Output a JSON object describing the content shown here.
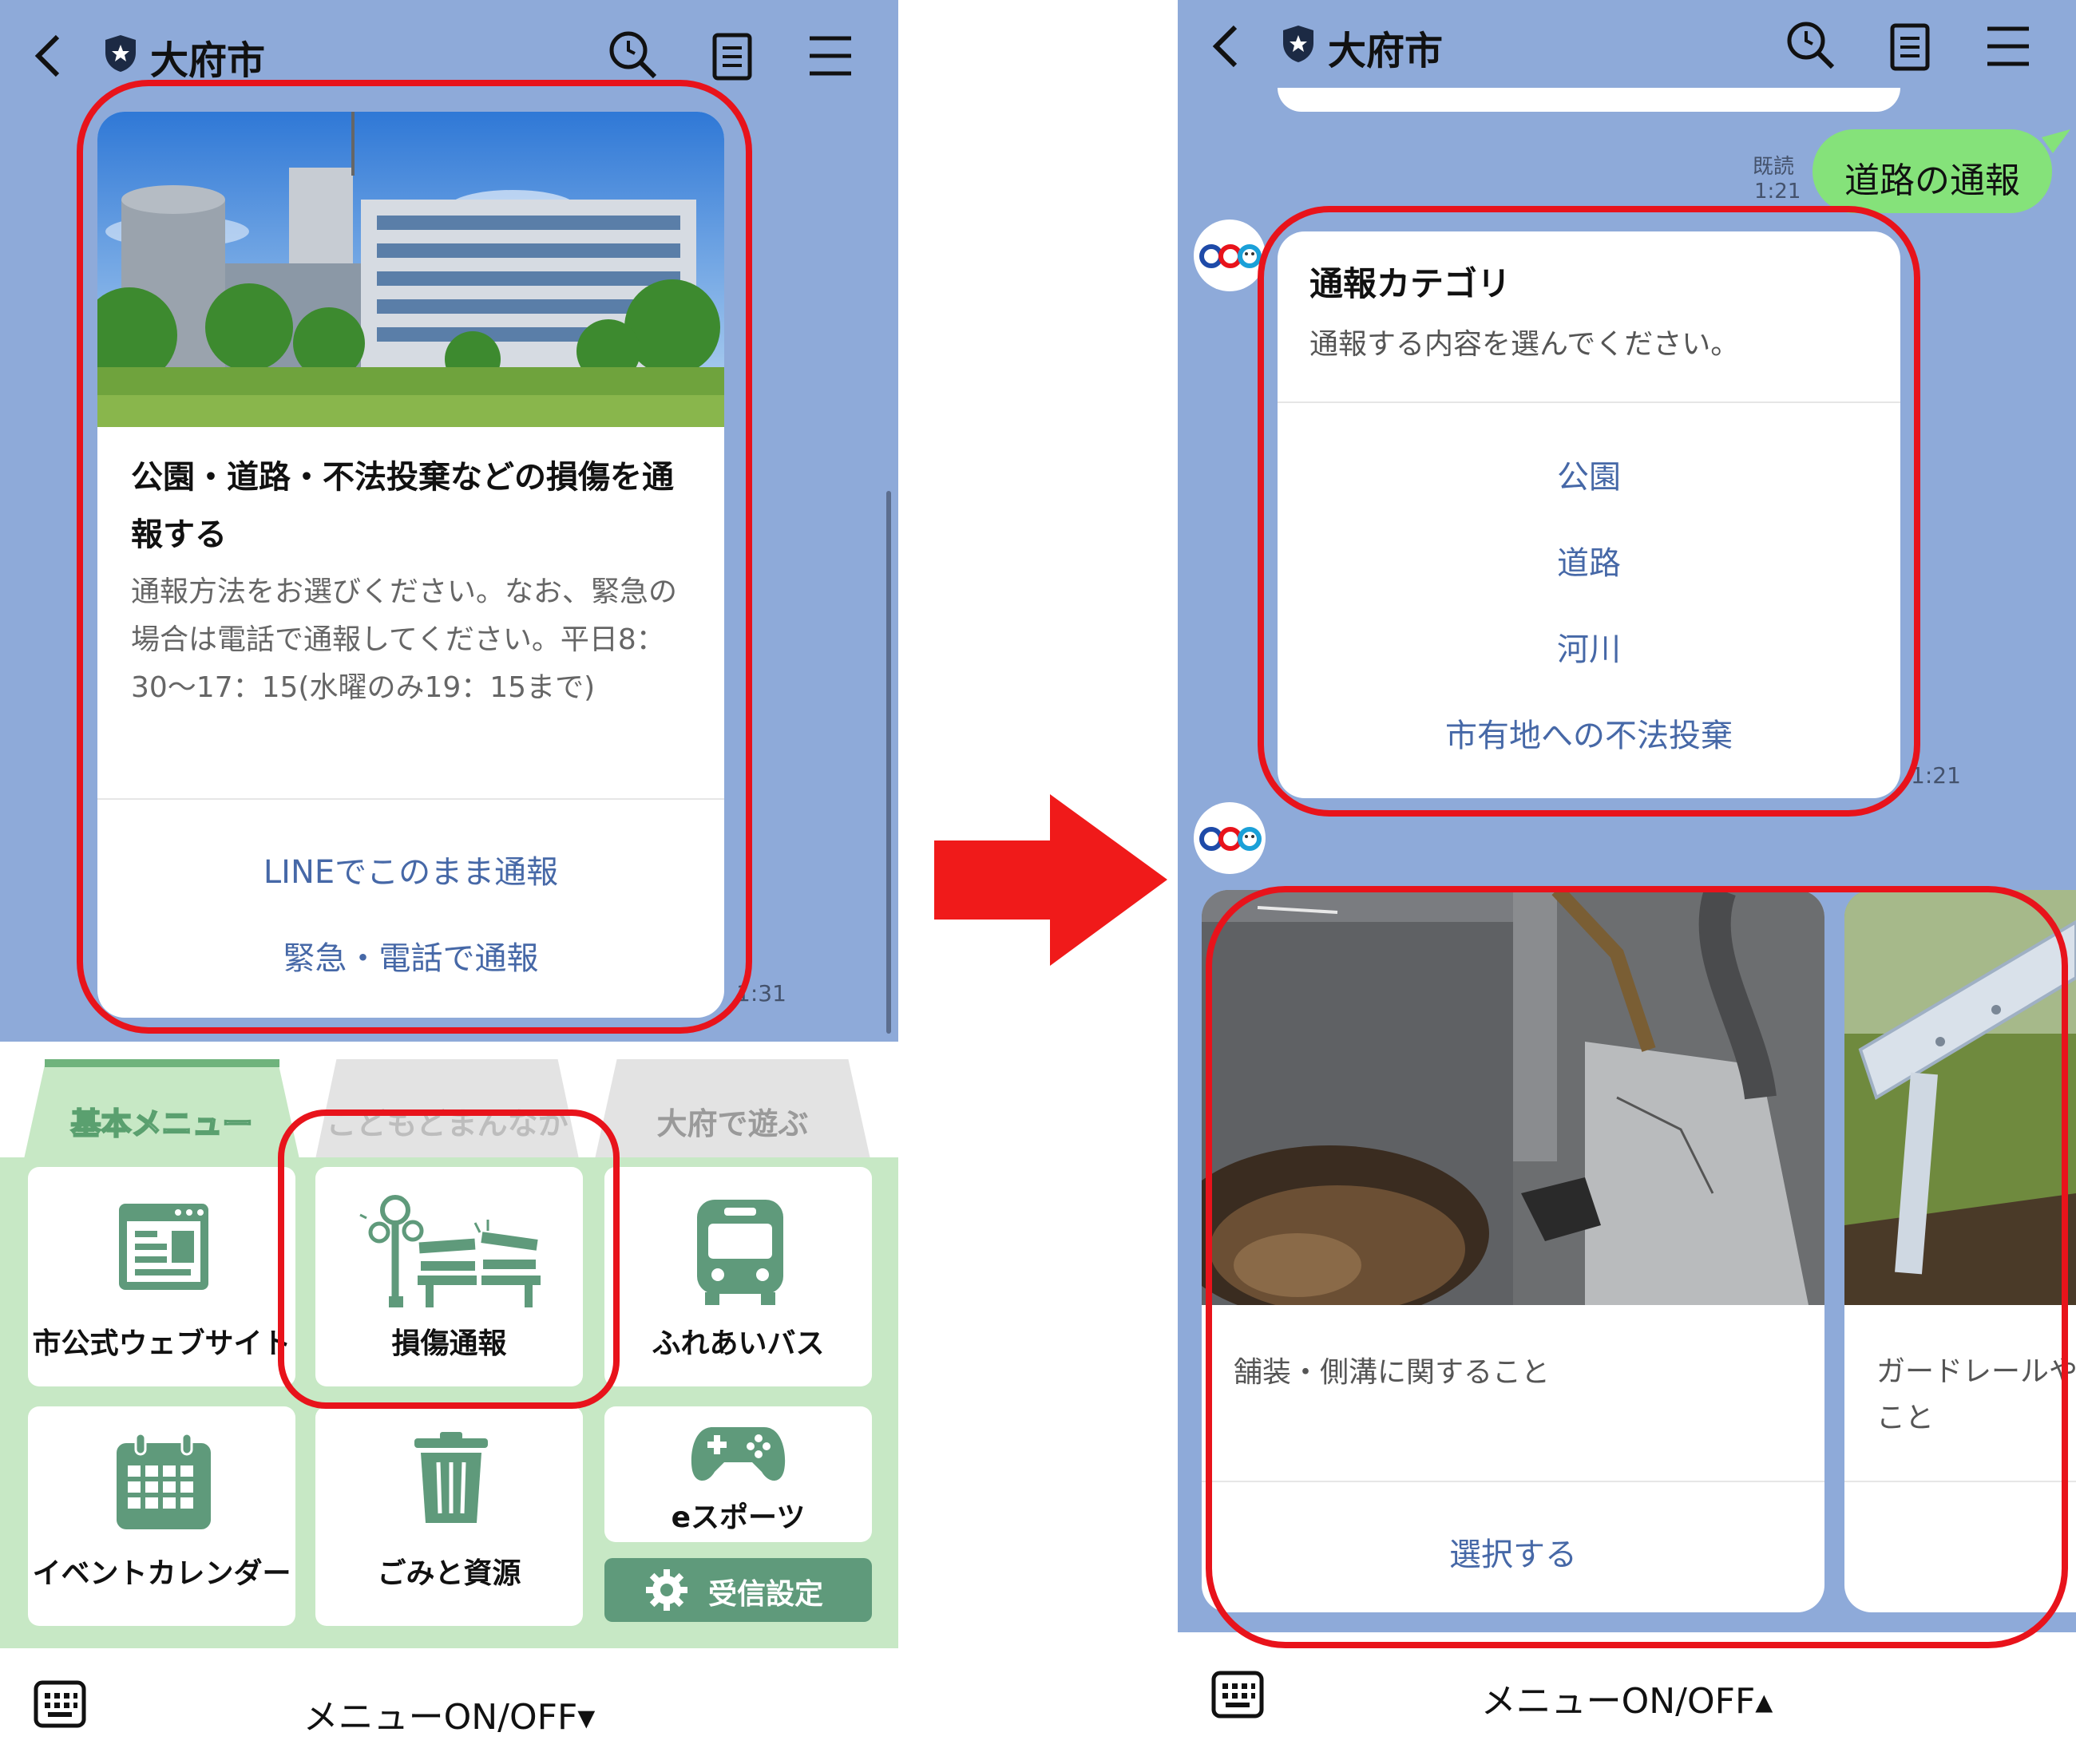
{
  "left": {
    "header": {
      "title": "大府市"
    },
    "card": {
      "heading": "公園・道路・不法投棄などの損傷を通報する",
      "body": "通報方法をお選びください。なお、緊急の場合は電話で通報してください。平日8：30〜17：15(水曜のみ19：15まで)",
      "button1": "LINEでこのまま通報",
      "button2": "緊急・電話で通報",
      "time": "1:31"
    },
    "menu": {
      "tabs": [
        "基本メニュー",
        "こどもどまんなか",
        "大府で遊ぶ"
      ],
      "tiles": [
        "市公式ウェブサイト",
        "損傷通報",
        "ふれあいバス",
        "イベントカレンダー",
        "ごみと資源",
        "eスポーツ",
        "受信設定"
      ]
    },
    "bottom": {
      "label": "メニューON/OFF▾"
    }
  },
  "right": {
    "header": {
      "title": "大府市"
    },
    "user_msg": {
      "text": "道路の通報",
      "read": "既読",
      "time": "1:21"
    },
    "category_card": {
      "title": "通報カテゴリ",
      "subtitle": "通報する内容を選んでください。",
      "options": [
        "公園",
        "道路",
        "河川",
        "市有地への不法投棄"
      ],
      "time": "1:21"
    },
    "carousel": {
      "card1_label": "舗装・側溝に関すること",
      "card1_button": "選択する",
      "card2_label": "ガードレールや\nこと"
    },
    "bottom": {
      "label": "メニューON/OFF▴"
    }
  },
  "colors": {
    "chat_bg": "#8eaad9",
    "menu_green": "#c7e8c5",
    "icon_green": "#5f9a7b",
    "link": "#4668a7",
    "line_green": "#85e27a",
    "highlight": "#e8131b"
  }
}
